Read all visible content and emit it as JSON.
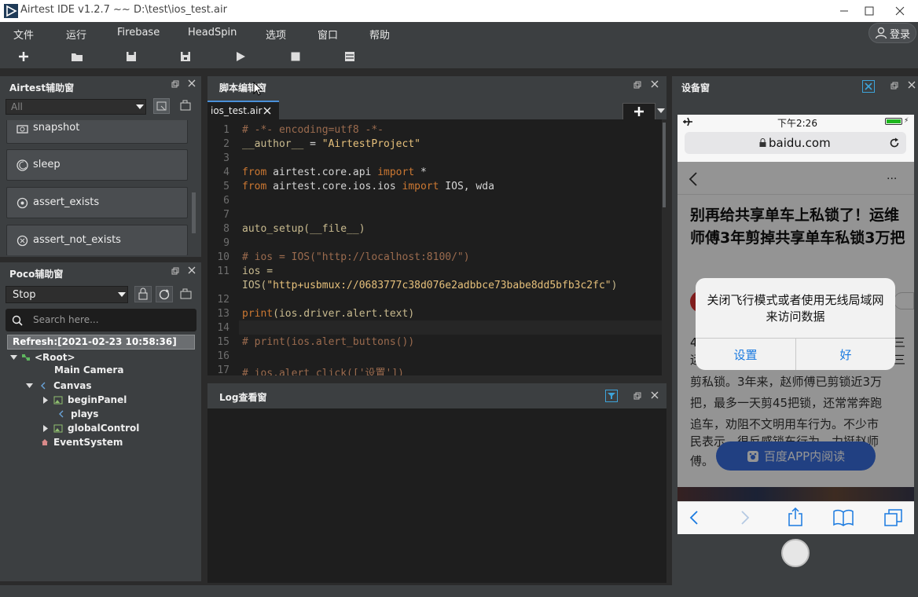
{
  "window": {
    "title": "Airtest IDE v1.2.7 ~~ D:\\test\\ios_test.air"
  },
  "menu": {
    "items": [
      "文件",
      "运行",
      "Firebase",
      "HeadSpin",
      "选项",
      "窗口",
      "帮助"
    ],
    "login_label": "登录"
  },
  "airtest_panel": {
    "title": "Airtest辅助窗",
    "filter_value": "All",
    "items": [
      "snapshot",
      "sleep",
      "assert_exists",
      "assert_not_exists"
    ]
  },
  "poco_panel": {
    "title": "Poco辅助窗",
    "mode_value": "Stop",
    "search_placeholder": "Search here...",
    "refresh": "Refresh:[2021-02-23 10:58:36]",
    "tree": {
      "root": "<Root>",
      "main_camera": "Main Camera",
      "canvas": "Canvas",
      "begin_panel": "beginPanel",
      "plays": "plays",
      "global_control": "globalControl",
      "event_system": "EventSystem"
    }
  },
  "script_panel": {
    "title": "脚本编辑窗",
    "tab": "ios_test.air",
    "line_numbers": [
      "1",
      "2",
      "3",
      "4",
      "5",
      "6",
      "7",
      "8",
      "9",
      "10",
      "11",
      "",
      "12",
      "13",
      "14",
      "15",
      "16",
      "17"
    ],
    "code": {
      "l1": "# -*- encoding=utf8 -*-",
      "l2a": "__author__",
      "l2b": " = ",
      "l2c": "\"AirtestProject\"",
      "l4a": "from",
      "l4b": " airtest.core.api ",
      "l4c": "import",
      "l4d": " *",
      "l5a": "from",
      "l5b": " airtest.core.ios.ios ",
      "l5c": "import",
      "l5d": " IOS, wda",
      "l8": "auto_setup(__file__)",
      "l10": "# ios = IOS(\"http://localhost:8100/\")",
      "l11a": "ios =",
      "l11b": "IOS(",
      "l11c": "\"http+usbmux://0683777c38d076e2adbbce73babe8dd5bfb3c2fc\"",
      "l11d": ")",
      "l13a": "print",
      "l13b": "(ios.driver.alert.text)",
      "l15": "# print(ios.alert_buttons())",
      "l17": "# ios.alert_click(['设置'])"
    }
  },
  "log_panel": {
    "title": "Log查看窗"
  },
  "device_panel": {
    "title": "设备窗",
    "status_time": "下午2:26",
    "url": "baidu.com",
    "headline": "别再给共享单车上私锁了！运维师傅3年剪掉共享单车私锁3万把",
    "body_lines": [
      "4",
      "运",
      "剪私锁。3年来，赵师傅已剪锁近3万",
      "把，最多一天剪45把锁，还常常奔跑",
      "追车，劝阻不文明用车行为。不少市",
      "民表示，很反感锁车行为，力挺赵师",
      "傅。"
    ],
    "right_chars": [
      "三",
      "三"
    ],
    "read_in_app": "百度APP内阅读",
    "alert": {
      "message": "关闭飞行模式或者使用无线局域网来访问数据",
      "button_settings": "设置",
      "button_ok": "好"
    }
  },
  "colors": {
    "accent_blue": "#3a6fe0",
    "ios_blue": "#1a7ae0",
    "comment": "#9b6b4e",
    "keyword": "#cc7832",
    "string": "#e6c07b"
  }
}
